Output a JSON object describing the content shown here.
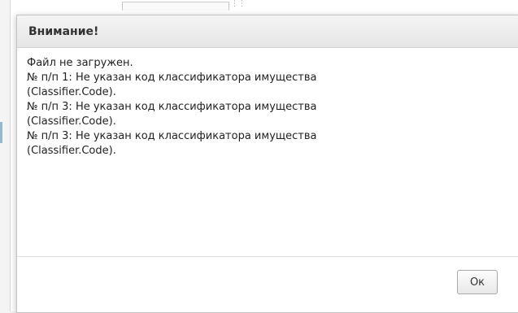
{
  "dialog": {
    "title": "Внимание!",
    "messages": [
      "Файл не загружен.",
      "№ п/п 1: Не указан код классификатора имущества",
      "(Classifier.Code).",
      "№ п/п 3: Не указан код классификатора имущества",
      "(Classifier.Code).",
      "№ п/п 3: Не указан код классификатора имущества",
      "(Classifier.Code)."
    ],
    "ok_label": "Ок"
  }
}
